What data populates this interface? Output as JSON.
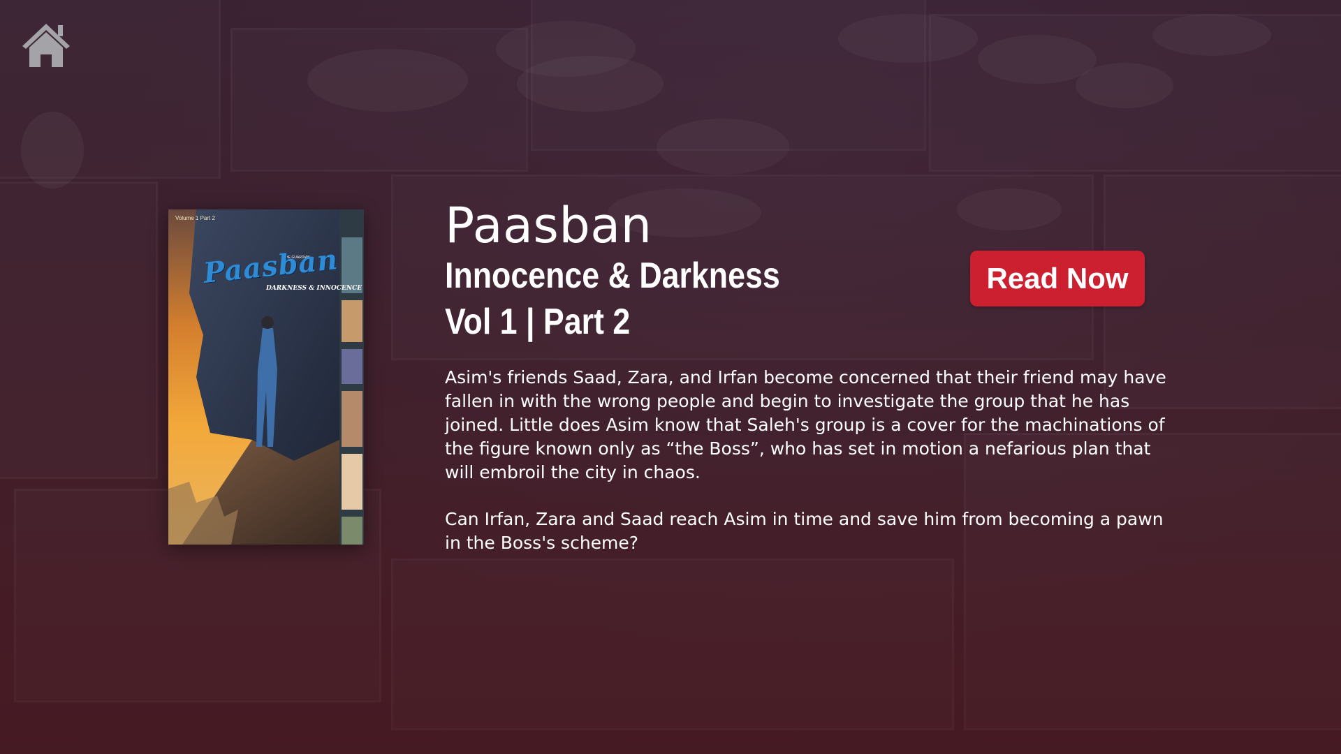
{
  "nav": {
    "home_icon": "home-icon"
  },
  "book": {
    "series_title": "Paasban",
    "issue_title": "Innocence & Darkness",
    "volume_part": "Vol 1 | Part 2",
    "synopsis": [
      "Asim's friends Saad, Zara, and Irfan become concerned that their friend may have fallen in with the wrong people and begin to investigate the group that he has joined.  Little does Asim know that Saleh's group is a cover for the machinations of the figure known only as “the Boss”, who has set in motion  a nefarious plan that will embroil the city in chaos.",
      "Can Irfan, Zara and Saad reach Asim in time and save him from becoming a pawn in the Boss's scheme?"
    ]
  },
  "cover": {
    "volume_label": "Volume 1 Part 2",
    "brand": "THE GUARDIAN",
    "title": "Paasban",
    "subtitle": "DARKNESS & INNOCENCE"
  },
  "actions": {
    "read_now_label": "Read Now"
  },
  "colors": {
    "accent": "#cc1f30",
    "background_top": "#3a2232",
    "background_bottom": "#4a1f27",
    "text": "#ffffff"
  }
}
